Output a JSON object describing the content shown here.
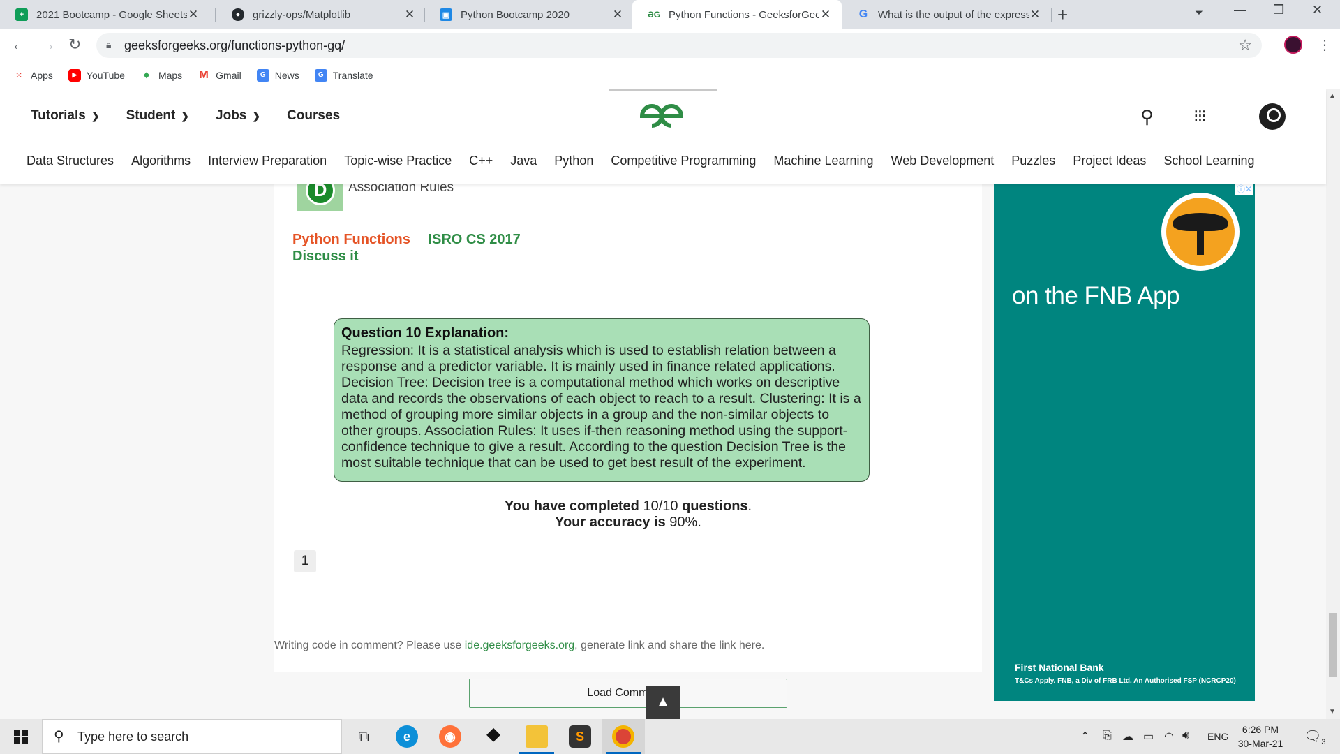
{
  "browser": {
    "tabs": [
      {
        "title": "2021 Bootcamp - Google Sheets",
        "icon": "sheets-icon",
        "color": "#0f9d58",
        "active": false
      },
      {
        "title": "grizzly-ops/Matplotlib",
        "icon": "github-icon",
        "color": "#24292e",
        "active": false
      },
      {
        "title": "Python Bootcamp 2020",
        "icon": "classroom-icon",
        "color": "#1e88e5",
        "active": false
      },
      {
        "title": "Python Functions - GeeksforGeeks",
        "icon": "gfg-icon",
        "color": "#2f8d46",
        "active": true
      },
      {
        "title": "What is the output of the expression",
        "icon": "google-icon",
        "color": "#4285f4",
        "active": false
      }
    ],
    "url": "geeksforgeeks.org/functions-python-gq/",
    "bookmarks": [
      {
        "label": "Apps",
        "icon": "apps-grid-icon"
      },
      {
        "label": "YouTube",
        "icon": "youtube-icon"
      },
      {
        "label": "Maps",
        "icon": "maps-icon"
      },
      {
        "label": "Gmail",
        "icon": "gmail-icon"
      },
      {
        "label": "News",
        "icon": "news-icon"
      },
      {
        "label": "Translate",
        "icon": "translate-icon"
      }
    ]
  },
  "site": {
    "top_nav": [
      "Tutorials",
      "Student",
      "Jobs",
      "Courses"
    ],
    "sub_nav": [
      "Data Structures",
      "Algorithms",
      "Interview Preparation",
      "Topic-wise Practice",
      "C++",
      "Java",
      "Python",
      "Competitive Programming",
      "Machine Learning",
      "Web Development",
      "Puzzles",
      "Project Ideas",
      "School Learning"
    ],
    "brand_color": "#2f8d46"
  },
  "quiz": {
    "option_letter": "D",
    "option_text": "Association Rules",
    "tag_topic": "Python Functions",
    "tag_exam": "ISRO CS 2017",
    "discuss": "Discuss it",
    "explanation_title": "Question 10 Explanation:",
    "explanation_body": "Regression: It is a statistical analysis which is used to establish relation between a response and a predictor variable. It is mainly used in finance related applications. Decision Tree: Decision tree is a computational method which works on descriptive data and records the observations of each object to reach to a result. Clustering: It is a method of grouping more similar objects in a group and the non-similar objects to other groups. Association Rules: It uses if-then reasoning method using the support-confidence technique to give a result. According to the question Decision Tree is the most suitable technique that can be used to get best result of the experiment.",
    "completed_prefix": "You have completed",
    "completed_value": "10/10",
    "completed_suffix": "questions",
    "accuracy_prefix": "Your accuracy is",
    "accuracy_value": "90%",
    "page_number": "1"
  },
  "comments": {
    "note_prefix": "Writing code in comment? Please use",
    "note_link": "ide.geeksforgeeks.org",
    "note_suffix": ", generate link and share the link here.",
    "load_button": "Load Comments",
    "back_to_top": "▲"
  },
  "ad": {
    "headline": "on the FNB App",
    "bank": "First National Bank",
    "legal": "T&Cs Apply. FNB, a Div of FRB Ltd. An Authorised FSP (NCRCP20)",
    "bg_color": "#00857f"
  },
  "taskbar": {
    "search_placeholder": "Type here to search",
    "language": "ENG",
    "time": "6:26 PM",
    "date": "30-Mar-21",
    "notifications": "3"
  }
}
